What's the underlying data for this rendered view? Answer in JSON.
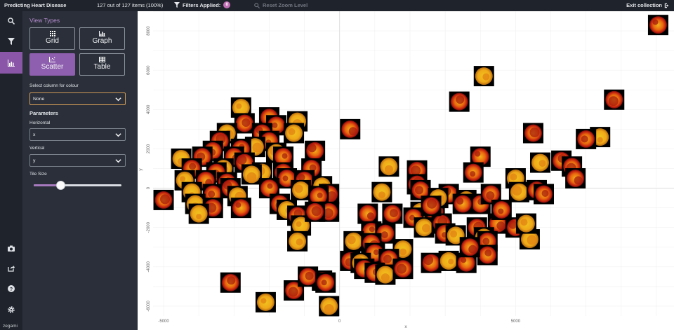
{
  "topbar": {
    "title": "Predicting Heart Disease",
    "item_count": "127 out of 127 items (100%)",
    "filters_label": "Filters Applied:",
    "filters_count": "0",
    "reset_zoom": "Reset Zoom Level",
    "exit": "Exit collection"
  },
  "rail": {
    "icons": [
      "search-icon",
      "filter-icon",
      "chart-icon",
      "camera-icon",
      "share-icon",
      "help-icon",
      "gear-icon"
    ],
    "brand": "zegami"
  },
  "panel": {
    "view_types_title": "View Types",
    "view_types": [
      {
        "label": "Grid",
        "icon": "grid-icon",
        "active": false
      },
      {
        "label": "Graph",
        "icon": "bar-chart-icon",
        "active": false
      },
      {
        "label": "Scatter",
        "icon": "scatter-icon",
        "active": true
      },
      {
        "label": "Table",
        "icon": "table-icon",
        "active": false
      }
    ],
    "colour_label": "Select column for colour",
    "colour_value": "None",
    "parameters_label": "Parameters",
    "horizontal_label": "Horizontal",
    "horizontal_value": "x",
    "vertical_label": "Vertical",
    "vertical_value": "y",
    "tile_size_label": "Tile Size",
    "tile_size_fraction": 0.3
  },
  "chart_data": {
    "type": "scatter",
    "xlabel": "x",
    "ylabel": "y",
    "xlim": [
      -5300,
      9500
    ],
    "ylim": [
      -6500,
      9000
    ],
    "xticks": [
      -5000,
      0,
      5000
    ],
    "yticks": [
      8000,
      6000,
      4000,
      2000,
      0,
      -2000,
      -4000,
      -6000
    ],
    "grid": true,
    "points": [
      [
        9050,
        8300
      ],
      [
        4100,
        5700
      ],
      [
        3400,
        4400
      ],
      [
        7800,
        4500
      ],
      [
        -2800,
        4100
      ],
      [
        -2000,
        3600
      ],
      [
        -2700,
        3300
      ],
      [
        -1200,
        3400
      ],
      [
        -1800,
        3200
      ],
      [
        -2200,
        2800
      ],
      [
        -3200,
        2800
      ],
      [
        -3400,
        2400
      ],
      [
        -2000,
        2400
      ],
      [
        -1300,
        2800
      ],
      [
        300,
        3000
      ],
      [
        5500,
        2800
      ],
      [
        7400,
        2600
      ],
      [
        7000,
        2500
      ],
      [
        -700,
        1900
      ],
      [
        -2400,
        2100
      ],
      [
        -2800,
        2000
      ],
      [
        -3600,
        1900
      ],
      [
        -1800,
        1800
      ],
      [
        -3000,
        1600
      ],
      [
        -1600,
        1600
      ],
      [
        -4500,
        1500
      ],
      [
        -3900,
        1600
      ],
      [
        -2700,
        1300
      ],
      [
        -3300,
        1000
      ],
      [
        -4200,
        1000
      ],
      [
        -3500,
        800
      ],
      [
        -2200,
        800
      ],
      [
        -1600,
        800
      ],
      [
        -800,
        1000
      ],
      [
        1400,
        1100
      ],
      [
        2200,
        900
      ],
      [
        4000,
        1600
      ],
      [
        5700,
        1300
      ],
      [
        6300,
        1400
      ],
      [
        6600,
        1100
      ],
      [
        -4400,
        400
      ],
      [
        -3800,
        400
      ],
      [
        -3200,
        300
      ],
      [
        -2500,
        700
      ],
      [
        -1500,
        500
      ],
      [
        -1000,
        400
      ],
      [
        -500,
        100
      ],
      [
        2200,
        200
      ],
      [
        3800,
        800
      ],
      [
        5000,
        500
      ],
      [
        6700,
        500
      ],
      [
        -5000,
        -600
      ],
      [
        -4200,
        -200
      ],
      [
        -3600,
        -300
      ],
      [
        -3100,
        0
      ],
      [
        -2900,
        -400
      ],
      [
        -2000,
        0
      ],
      [
        -1700,
        -800
      ],
      [
        -1100,
        -100
      ],
      [
        -300,
        -300
      ],
      [
        -600,
        -400
      ],
      [
        1200,
        -200
      ],
      [
        2300,
        -100
      ],
      [
        3100,
        -300
      ],
      [
        3600,
        -600
      ],
      [
        4000,
        -800
      ],
      [
        4300,
        -300
      ],
      [
        5100,
        -200
      ],
      [
        5600,
        -100
      ],
      [
        5800,
        -300
      ],
      [
        -4100,
        -800
      ],
      [
        -3600,
        -1000
      ],
      [
        -2800,
        -1000
      ],
      [
        -1500,
        -1100
      ],
      [
        -1200,
        -1400
      ],
      [
        -300,
        -1200
      ],
      [
        -1100,
        -1900
      ],
      [
        800,
        -1300
      ],
      [
        1500,
        -1300
      ],
      [
        2300,
        -1200
      ],
      [
        2100,
        -1500
      ],
      [
        2700,
        -1200
      ],
      [
        2400,
        -2000
      ],
      [
        2900,
        -1800
      ],
      [
        3000,
        -2300
      ],
      [
        3300,
        -2400
      ],
      [
        4500,
        -1800
      ],
      [
        3900,
        -2000
      ],
      [
        4100,
        -2500
      ],
      [
        4200,
        -2700
      ],
      [
        5000,
        -2000
      ],
      [
        5400,
        -2600
      ],
      [
        900,
        -2200
      ],
      [
        1300,
        -2300
      ],
      [
        400,
        -2700
      ],
      [
        900,
        -2800
      ],
      [
        1000,
        -3300
      ],
      [
        1800,
        -3100
      ],
      [
        1400,
        -3600
      ],
      [
        2600,
        -3800
      ],
      [
        3100,
        -3700
      ],
      [
        4200,
        -3400
      ],
      [
        300,
        -3700
      ],
      [
        600,
        -3800
      ],
      [
        700,
        -4100
      ],
      [
        1000,
        -4300
      ],
      [
        1300,
        -4400
      ],
      [
        1800,
        -4100
      ],
      [
        3600,
        -3800
      ],
      [
        -1200,
        -2700
      ],
      [
        -3100,
        -4800
      ],
      [
        -1300,
        -5200
      ],
      [
        -2100,
        -5800
      ],
      [
        -500,
        -4700
      ],
      [
        -900,
        -4500
      ],
      [
        -300,
        -6000
      ],
      [
        -400,
        -4800
      ],
      [
        3500,
        -800
      ],
      [
        2800,
        -500
      ],
      [
        2600,
        -900
      ],
      [
        4600,
        -1100
      ],
      [
        5300,
        -1800
      ],
      [
        3700,
        -3000
      ],
      [
        -700,
        -1200
      ],
      [
        -4000,
        -1300
      ]
    ]
  }
}
